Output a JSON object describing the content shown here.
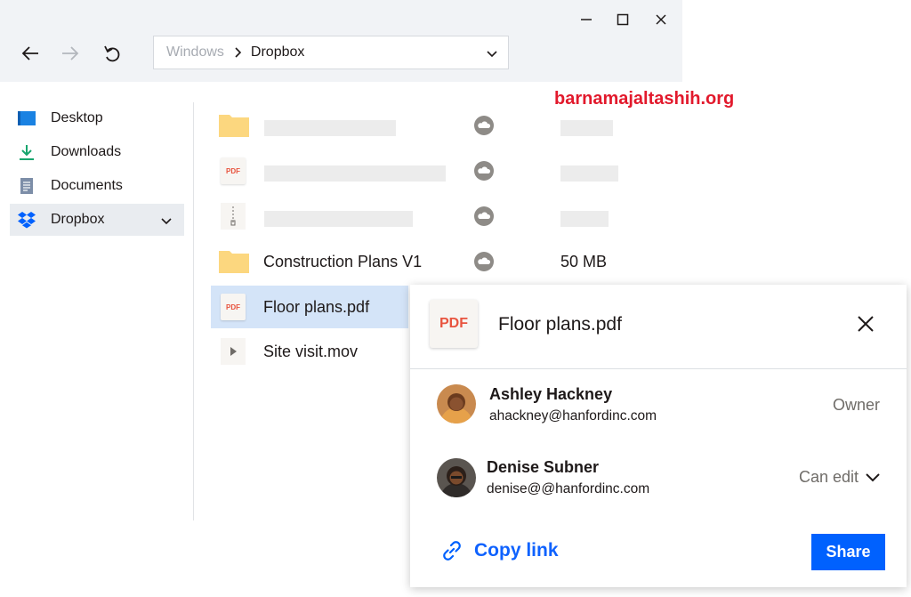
{
  "window": {
    "controls": {
      "minimize_icon": "minimize-icon",
      "maximize_icon": "maximize-icon",
      "close_icon": "close-icon"
    }
  },
  "toolbar": {
    "back_icon": "arrow-left-icon",
    "forward_icon": "arrow-right-icon",
    "refresh_icon": "undo-refresh-icon"
  },
  "address_bar": {
    "crumbs": [
      "Windows",
      "Dropbox"
    ],
    "dropdown_icon": "chevron-down-icon"
  },
  "sidebar": {
    "items": [
      {
        "label": "Desktop",
        "icon": "desktop-icon",
        "active": false
      },
      {
        "label": "Downloads",
        "icon": "download-icon",
        "active": false
      },
      {
        "label": "Documents",
        "icon": "document-icon",
        "active": false
      },
      {
        "label": "Dropbox",
        "icon": "dropbox-icon",
        "active": true
      }
    ]
  },
  "files": [
    {
      "name": "",
      "type": "folder",
      "size": ""
    },
    {
      "name": "",
      "type": "pdf",
      "size": ""
    },
    {
      "name": "",
      "type": "zip",
      "size": ""
    },
    {
      "name": "Construction Plans V1",
      "type": "folder",
      "size": "50 MB"
    },
    {
      "name": "Floor plans.pdf",
      "type": "pdf",
      "size": "",
      "selected": true
    },
    {
      "name": "Site visit.mov",
      "type": "video",
      "size": ""
    }
  ],
  "file_type_labels": {
    "pdf": "PDF"
  },
  "watermark": "barnamajaltashih.org",
  "share_panel": {
    "file_type": "PDF",
    "file_name": "Floor plans.pdf",
    "members": [
      {
        "name": "Ashley Hackney",
        "email": "ahackney@hanfordinc.com",
        "role": "Owner"
      },
      {
        "name": "Denise Subner",
        "email": "denise@@hanfordinc.com",
        "role": "Can edit"
      }
    ],
    "copy_link_label": "Copy link",
    "share_label": "Share"
  },
  "colors": {
    "accent": "#0061fe",
    "selection": "#d4e4f8",
    "folder": "#fcd77f",
    "pdf_red": "#e8543f",
    "watermark": "#e2192c"
  }
}
